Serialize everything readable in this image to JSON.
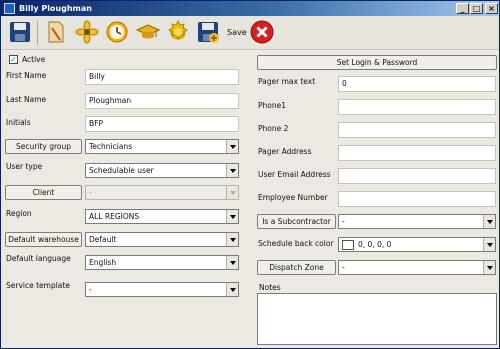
{
  "window": {
    "title": "Billy Ploughman"
  },
  "toolbar": {
    "save_label": "Save"
  },
  "left": {
    "active_label": "Active",
    "first_name": {
      "label": "First Name",
      "value": "Billy"
    },
    "last_name": {
      "label": "Last Name",
      "value": "Ploughman"
    },
    "initials": {
      "label": "Initials",
      "value": "BFP"
    },
    "security_group": {
      "button": "Security group",
      "value": "Technicians"
    },
    "user_type": {
      "label": "User type",
      "value": "Schedulable user"
    },
    "client": {
      "button": "Client",
      "value": "-"
    },
    "region": {
      "label": "Region",
      "value": "ALL REGIONS"
    },
    "default_warehouse": {
      "button": "Default warehouse",
      "value": "Default"
    },
    "default_language": {
      "label": "Default language",
      "value": "English"
    },
    "service_template": {
      "label": "Service template",
      "value": "-"
    }
  },
  "right": {
    "login_button": "Set Login & Password",
    "pager_max_text": {
      "label": "Pager max text",
      "value": "0"
    },
    "phone1": {
      "label": "Phone1",
      "value": ""
    },
    "phone2": {
      "label": "Phone 2",
      "value": ""
    },
    "pager_address": {
      "label": "Pager Address",
      "value": ""
    },
    "user_email": {
      "label": "User Email Address",
      "value": ""
    },
    "employee_number": {
      "label": "Employee Number",
      "value": ""
    },
    "subcontractor": {
      "button": "Is a Subcontractor",
      "value": "-"
    },
    "schedule_color": {
      "label": "Schedule back color",
      "value": "0, 0, 0, 0"
    },
    "dispatch_zone": {
      "button": "Dispatch Zone",
      "value": "-"
    },
    "notes_label": "Notes"
  }
}
